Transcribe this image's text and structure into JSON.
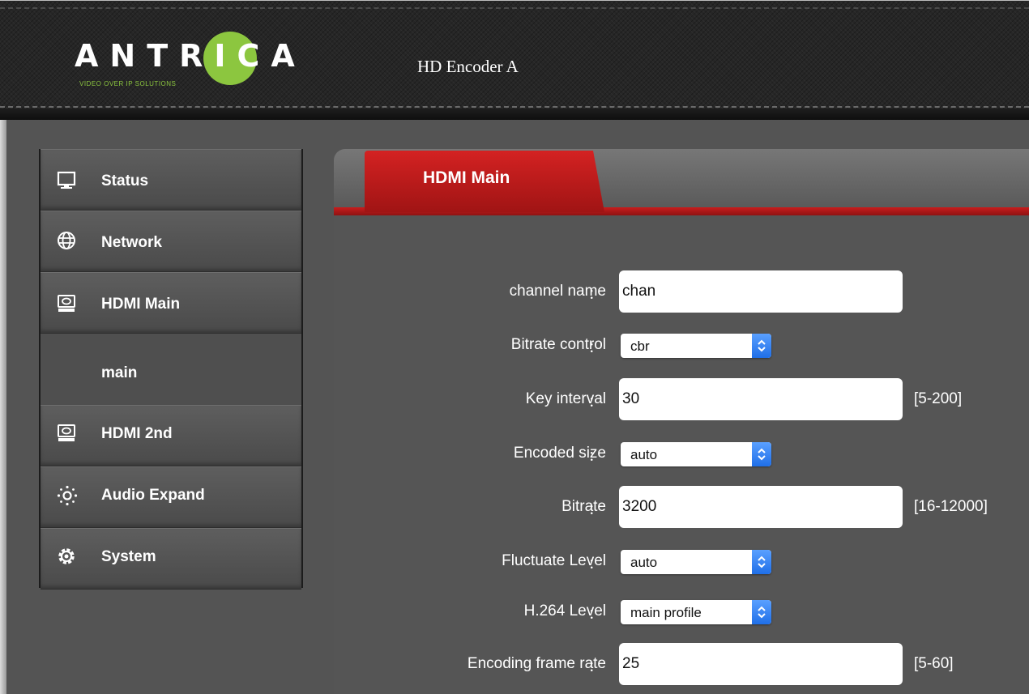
{
  "header": {
    "logo_text": "ANTRICA",
    "logo_tagline": "VIDEO OVER IP SOLUTIONS",
    "device_title": "HD Encoder  A"
  },
  "sidebar": {
    "items": [
      {
        "label": "Status",
        "icon": "monitor-icon"
      },
      {
        "label": "Network",
        "icon": "globe-icon"
      },
      {
        "label": "HDMI Main",
        "icon": "hdmi-device-icon"
      },
      {
        "label": "main",
        "icon": ""
      },
      {
        "label": "HDMI 2nd",
        "icon": "hdmi-device-icon"
      },
      {
        "label": "Audio Expand",
        "icon": "audio-dots-icon"
      },
      {
        "label": "System",
        "icon": "gear-icon"
      }
    ]
  },
  "main": {
    "active_tab": "HDMI Main",
    "form": {
      "channel_name": {
        "label": "channel name",
        "value": "chan"
      },
      "bitrate_control": {
        "label": "Bitrate control",
        "value": "cbr"
      },
      "key_interval": {
        "label": "Key interval",
        "value": "30",
        "range": "[5-200]"
      },
      "encoded_size": {
        "label": "Encoded size",
        "value": "auto"
      },
      "bitrate": {
        "label": "Bitrate",
        "value": "3200",
        "range": "[16-12000]"
      },
      "fluctuate_level": {
        "label": "Fluctuate Level",
        "value": "auto"
      },
      "h264_level": {
        "label": "H.264 Level",
        "value": "main profile"
      },
      "encoding_frame_rate": {
        "label": "Encoding frame rate",
        "value": "25",
        "range": "[5-60]"
      },
      "colon": "："
    }
  },
  "colors": {
    "accent_red": "#c81d1d",
    "logo_green": "#8cc63f",
    "panel_bg": "#555555",
    "select_blue": "#1f6fe8"
  }
}
